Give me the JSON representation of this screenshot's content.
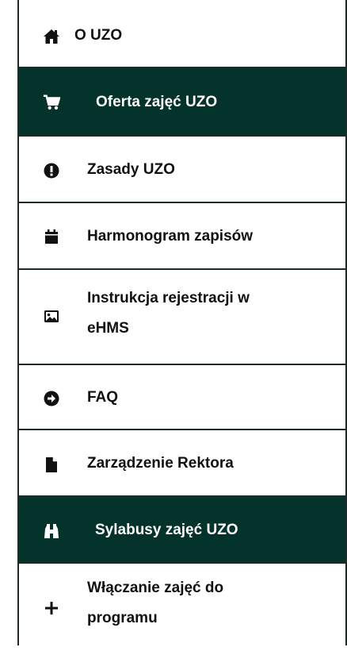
{
  "menu": {
    "items": [
      {
        "label": "O UZO",
        "icon": "home-icon",
        "active": false
      },
      {
        "label": "Oferta zajęć UZO",
        "icon": "cart-icon",
        "active": true
      },
      {
        "label": "Zasady UZO",
        "icon": "exclamation-circle-icon",
        "active": false
      },
      {
        "label": "Harmonogram zapisów",
        "icon": "calendar-icon",
        "active": false
      },
      {
        "label": "Instrukcja rejestracji w eHMS",
        "icon": "image-icon",
        "active": false
      },
      {
        "label": "FAQ",
        "icon": "arrow-circle-right-icon",
        "active": false
      },
      {
        "label": "Zarządzenie Rektora",
        "icon": "file-icon",
        "active": false
      },
      {
        "label": "Sylabusy zajęć UZO",
        "icon": "binoculars-icon",
        "active": true
      },
      {
        "label": "Włączanie zajęć do programu",
        "icon": "plus-icon",
        "active": false
      }
    ]
  },
  "colors": {
    "active_bg": "#04332b",
    "border": "#1e2a26",
    "text": "#111111",
    "active_text": "#ffffff"
  }
}
